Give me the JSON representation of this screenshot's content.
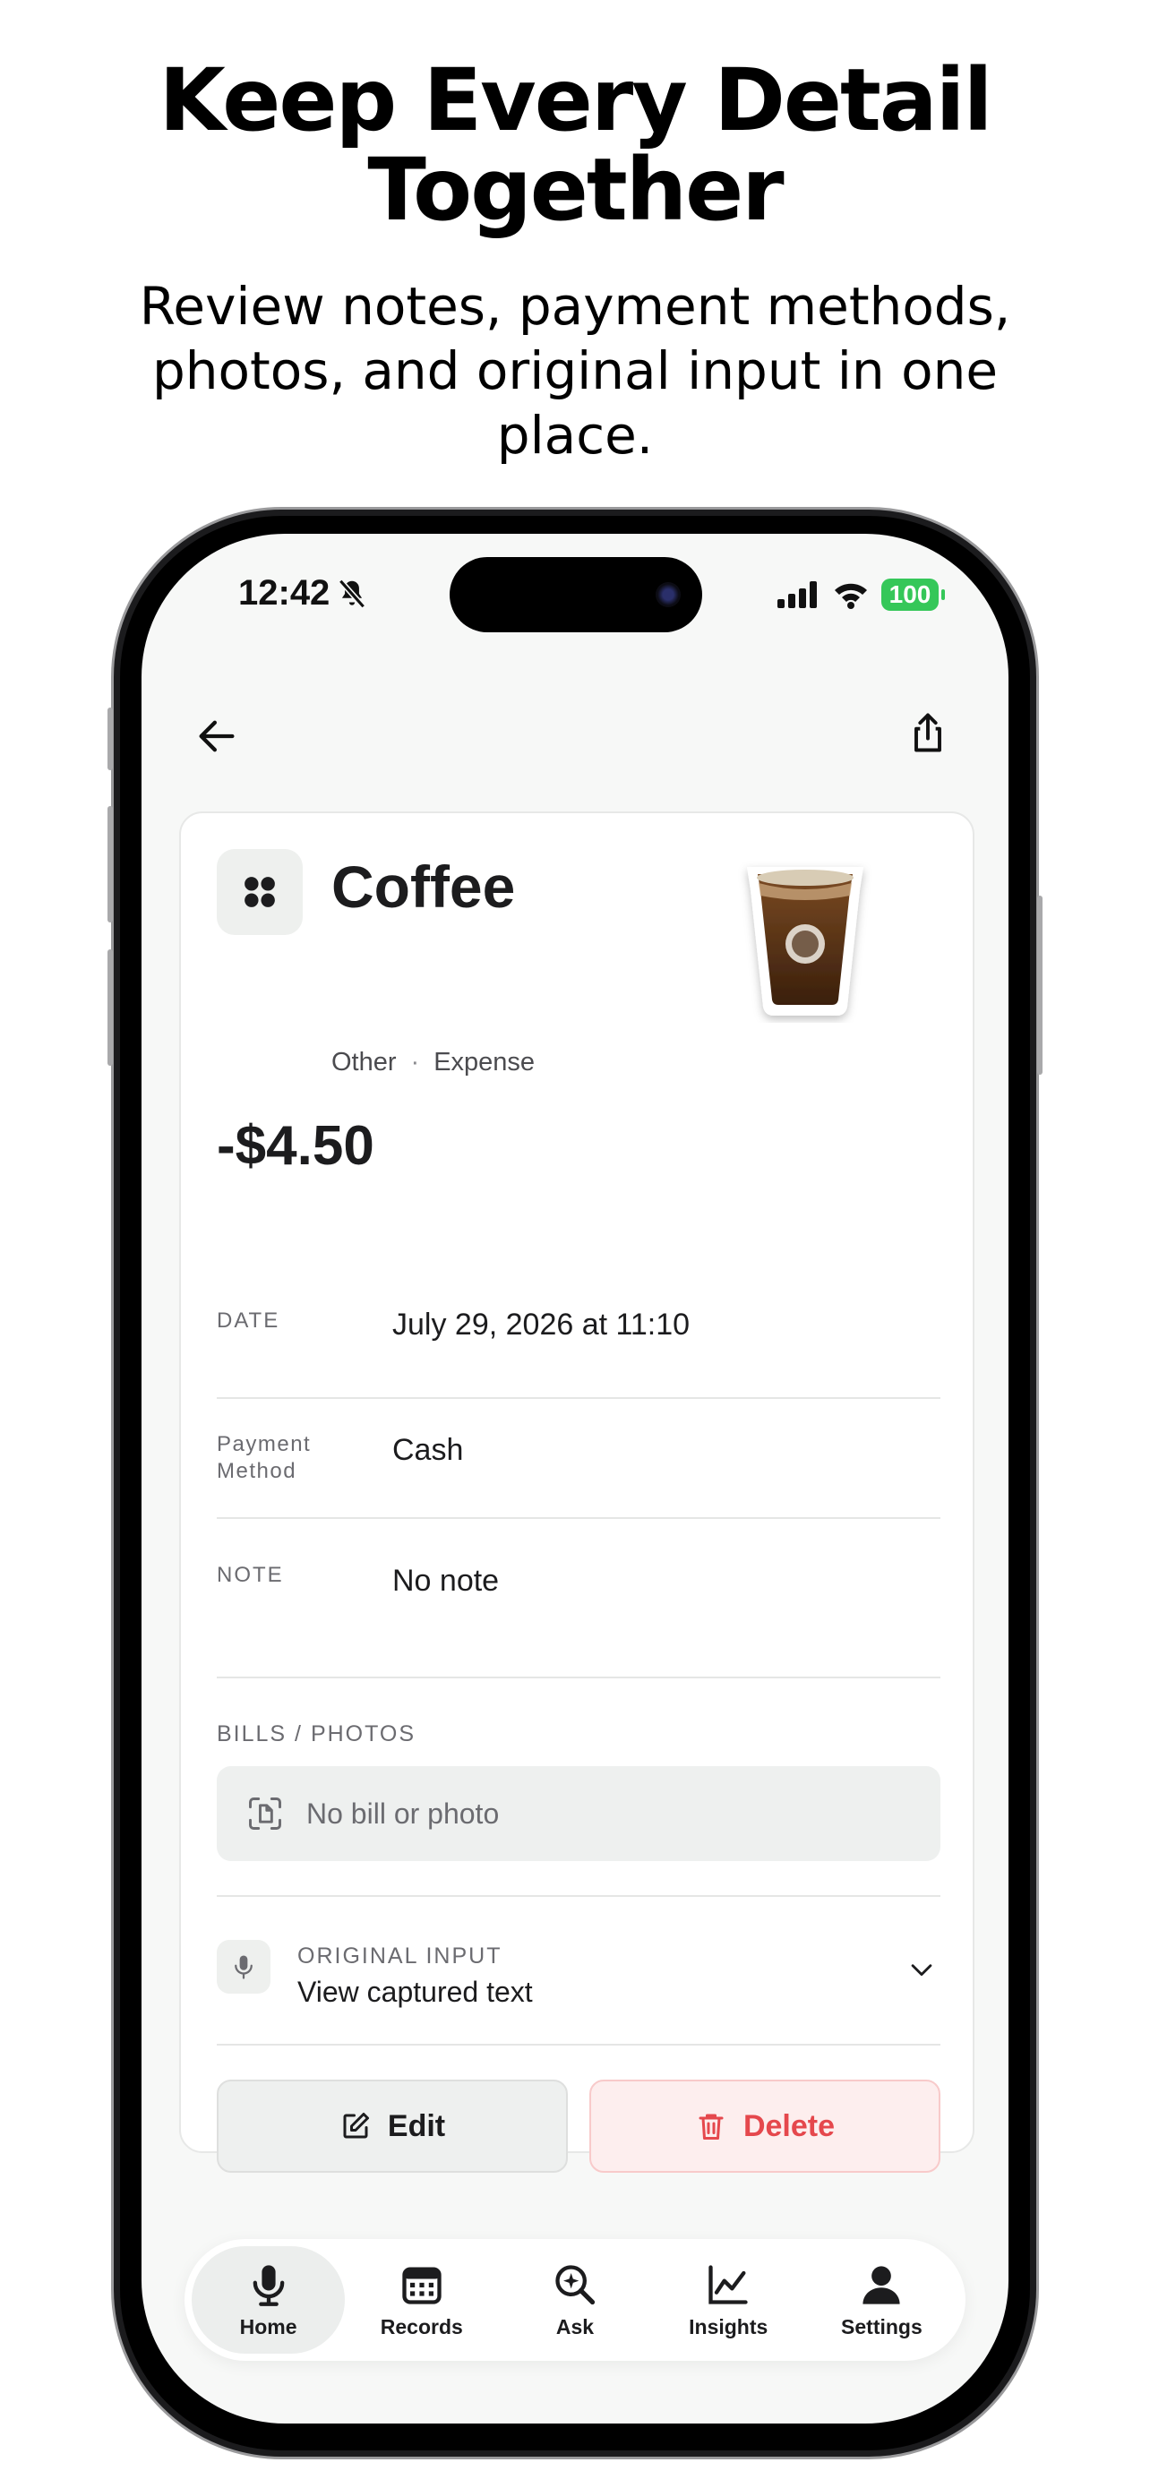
{
  "marketing": {
    "headline_line1": "Keep Every Detail",
    "headline_line2": "Together",
    "subheadline": "Review notes, payment methods, photos, and original input in one place."
  },
  "status_bar": {
    "time": "12:42",
    "battery": "100",
    "icons": [
      "bell-slash-icon",
      "signal-icon",
      "wifi-icon",
      "battery-icon"
    ]
  },
  "nav": {
    "back_icon": "arrow-left-icon",
    "share_icon": "share-icon"
  },
  "record": {
    "category_icon": "grid-dots-icon",
    "title": "Coffee",
    "category": "Other",
    "separator": "·",
    "type": "Expense",
    "amount": "-$4.50",
    "fields": {
      "date_label": "DATE",
      "date_value": "July 29, 2026 at 11:10",
      "payment_label": "Payment Method",
      "payment_value": "Cash",
      "note_label": "NOTE",
      "note_value": "No note"
    },
    "bills_label": "BILLS / PHOTOS",
    "bills_empty": "No bill or photo",
    "original_input_label": "ORIGINAL INPUT",
    "original_input_value": "View captured text",
    "edit_label": "Edit",
    "delete_label": "Delete"
  },
  "tabs": [
    {
      "label": "Home",
      "icon": "mic-icon",
      "active": true
    },
    {
      "label": "Records",
      "icon": "calendar-icon",
      "active": false
    },
    {
      "label": "Ask",
      "icon": "search-sparkle-icon",
      "active": false
    },
    {
      "label": "Insights",
      "icon": "chart-line-icon",
      "active": false
    },
    {
      "label": "Settings",
      "icon": "person-icon",
      "active": false
    }
  ],
  "colors": {
    "accent_delete": "#e5484d",
    "battery_green": "#35c759",
    "screen_bg": "#f7f8f7"
  }
}
